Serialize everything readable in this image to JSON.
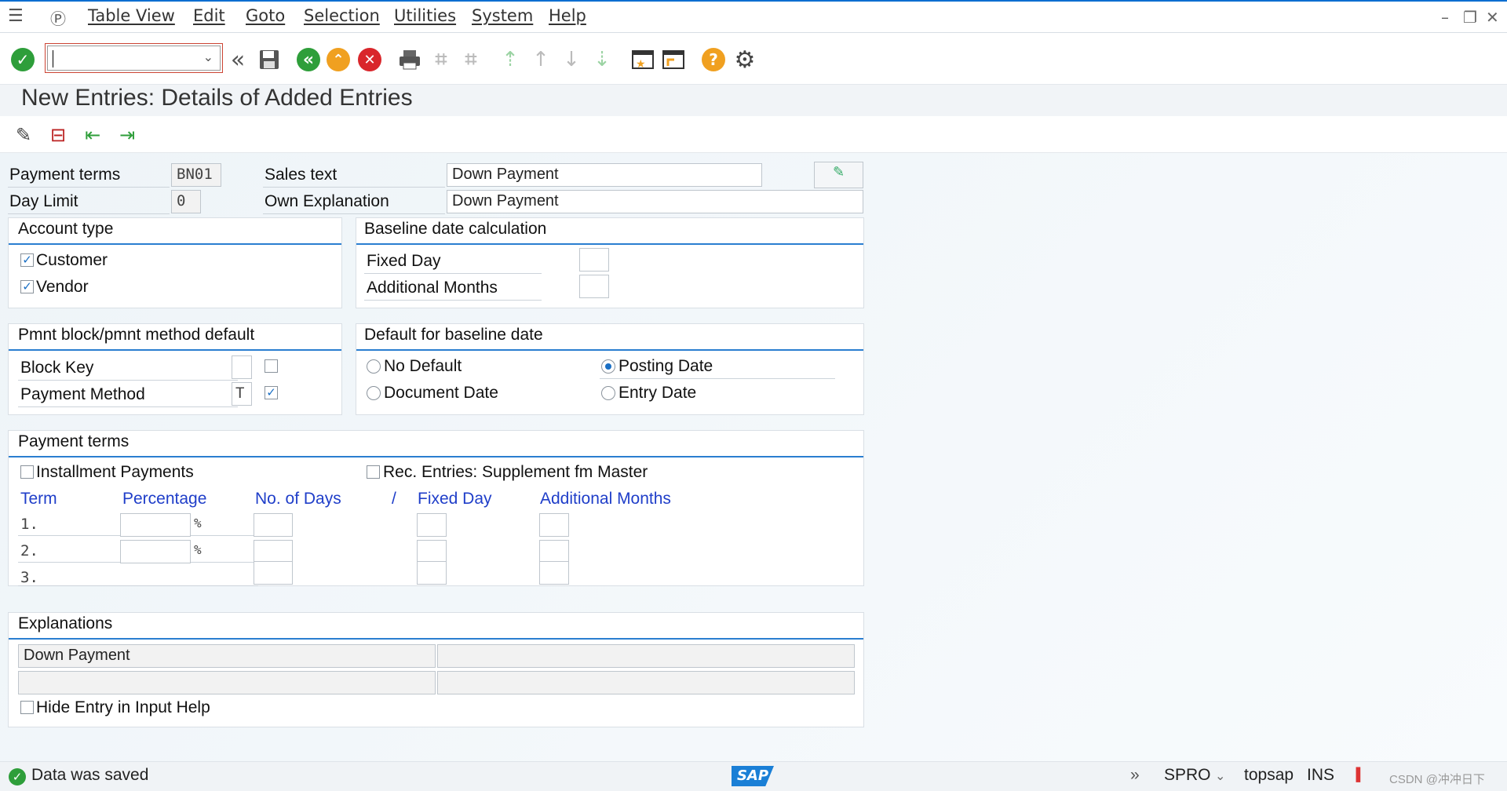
{
  "menu": {
    "items": [
      "Table View",
      "Edit",
      "Goto",
      "Selection",
      "Utilities",
      "System",
      "Help"
    ]
  },
  "title": "New Entries: Details of Added Entries",
  "header_fields": {
    "payment_terms_label": "Payment terms",
    "payment_terms_value": "BN01",
    "day_limit_label": "Day Limit",
    "day_limit_value": "0",
    "sales_text_label": "Sales text",
    "sales_text_value": "Down Payment",
    "own_explanation_label": "Own Explanation",
    "own_explanation_value": "Down Payment"
  },
  "account_type": {
    "title": "Account type",
    "customer_label": "Customer",
    "customer_checked": true,
    "vendor_label": "Vendor",
    "vendor_checked": true
  },
  "baseline_calc": {
    "title": "Baseline date calculation",
    "fixed_day_label": "Fixed Day",
    "additional_months_label": "Additional Months"
  },
  "pmnt_block": {
    "title": "Pmnt block/pmnt method default",
    "block_key_label": "Block Key",
    "block_key_value": "",
    "payment_method_label": "Payment Method",
    "payment_method_value": "T",
    "payment_method_checked": true
  },
  "default_baseline": {
    "title": "Default for baseline date",
    "no_default": "No Default",
    "document_date": "Document Date",
    "posting_date": "Posting Date",
    "entry_date": "Entry Date",
    "selected": "Posting Date"
  },
  "payment_terms_group": {
    "title": "Payment terms",
    "installment_label": "Installment Payments",
    "rec_entries_label": "Rec. Entries: Supplement fm Master",
    "columns": {
      "term": "Term",
      "percentage": "Percentage",
      "no_of_days": "No. of Days",
      "slash": "/",
      "fixed_day": "Fixed Day",
      "additional_months": "Additional Months"
    },
    "rows": [
      {
        "term": "1.",
        "percent_sign": "%"
      },
      {
        "term": "2.",
        "percent_sign": "%"
      },
      {
        "term": "3."
      }
    ]
  },
  "explanations": {
    "title": "Explanations",
    "row1_left": "Down Payment",
    "hide_entry_label": "Hide Entry in Input Help"
  },
  "status": {
    "message": "Data was saved",
    "transaction": "SPRO",
    "user": "topsap",
    "mode": "INS",
    "logo": "SAP",
    "watermark": "CSDN @冲冲日下"
  },
  "icons": {
    "save": "save-icon",
    "back": "back-icon",
    "exit": "exit-icon",
    "cancel": "cancel-icon",
    "help": "help-icon"
  },
  "colors": {
    "accent": "#2a7ed0",
    "green": "#2e9e3a",
    "orange": "#f0a020",
    "red": "#d9262b",
    "label_blue": "#1f3ec9"
  }
}
